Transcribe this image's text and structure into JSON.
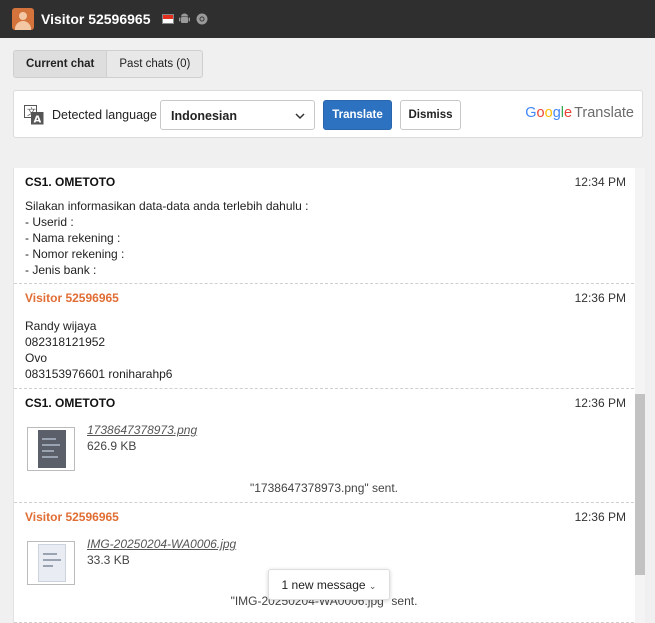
{
  "window": {
    "visitor_name": "Visitor 52596965",
    "icons": [
      "user-avatar-icon",
      "indonesia-flag-icon",
      "android-icon",
      "chrome-icon"
    ]
  },
  "tabs": [
    {
      "label": "Current chat",
      "active": true
    },
    {
      "label": "Past chats (0)",
      "active": false
    }
  ],
  "translate_bar": {
    "detected_label": "Detected language",
    "language": "Indonesian",
    "translate_button": "Translate",
    "dismiss_button": "Dismiss",
    "logo_text": "Translate"
  },
  "messages": [
    {
      "author": "CS1. OMETOTO",
      "role": "operator",
      "time": "12:34 PM",
      "lines": [
        "Silakan informasikan data-data anda terlebih dahulu :",
        "- Userid :",
        "- Nama rekening :",
        "- Nomor rekening :",
        "- Jenis bank :"
      ]
    },
    {
      "author": "Visitor 52596965",
      "role": "visitor",
      "time": "12:36 PM",
      "lines": [
        "Randy wijaya",
        "082318121952",
        "Ovo",
        "083153976601 roniharahp6"
      ]
    },
    {
      "author": "CS1. OMETOTO",
      "role": "operator",
      "time": "12:36 PM",
      "file_name": "1738647378973.png",
      "file_size": "626.9 KB",
      "sent_text": "\"1738647378973.png\" sent."
    },
    {
      "author": "Visitor 52596965",
      "role": "visitor",
      "time": "12:36 PM",
      "file_name": "IMG-20250204-WA0006.jpg",
      "file_size": "33.3 KB",
      "sent_text": "\"IMG-20250204-WA0006.jpg\" sent."
    }
  ],
  "new_message_pill": "1 new message",
  "colors": {
    "titlebar": "#2f2f2f",
    "visitor_name": "#e06d34",
    "translate_button": "#2d72c1"
  }
}
